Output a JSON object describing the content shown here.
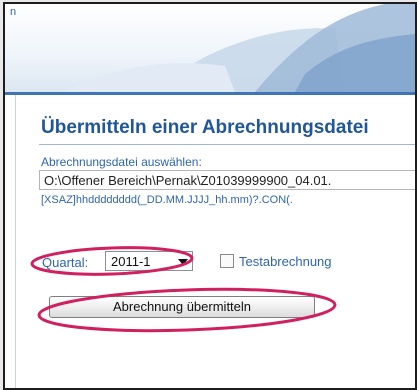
{
  "header": {
    "corner_text": "n"
  },
  "form": {
    "title": "Übermitteln einer Abrechnungsdatei",
    "select_file_label": "Abrechnungsdatei auswählen:",
    "file_path_value": "O:\\Offener Bereich\\Pernak\\Z01039999900_04.01.",
    "filename_pattern": "[XSAZ]hhdddddddd(_DD.MM.JJJJ_hh.mm)?.CON(.",
    "quartal_label": "Quartal:",
    "quartal_value": "2011-1",
    "test_label": "Testabrechnung",
    "test_checked": false,
    "submit_label": "Abrechnung übermitteln"
  },
  "colors": {
    "accent_blue": "#1f5799",
    "label_blue": "#2e66ad",
    "annotation_red": "#d1205f"
  },
  "icons": {
    "dropdown": "chevron-down-icon"
  }
}
